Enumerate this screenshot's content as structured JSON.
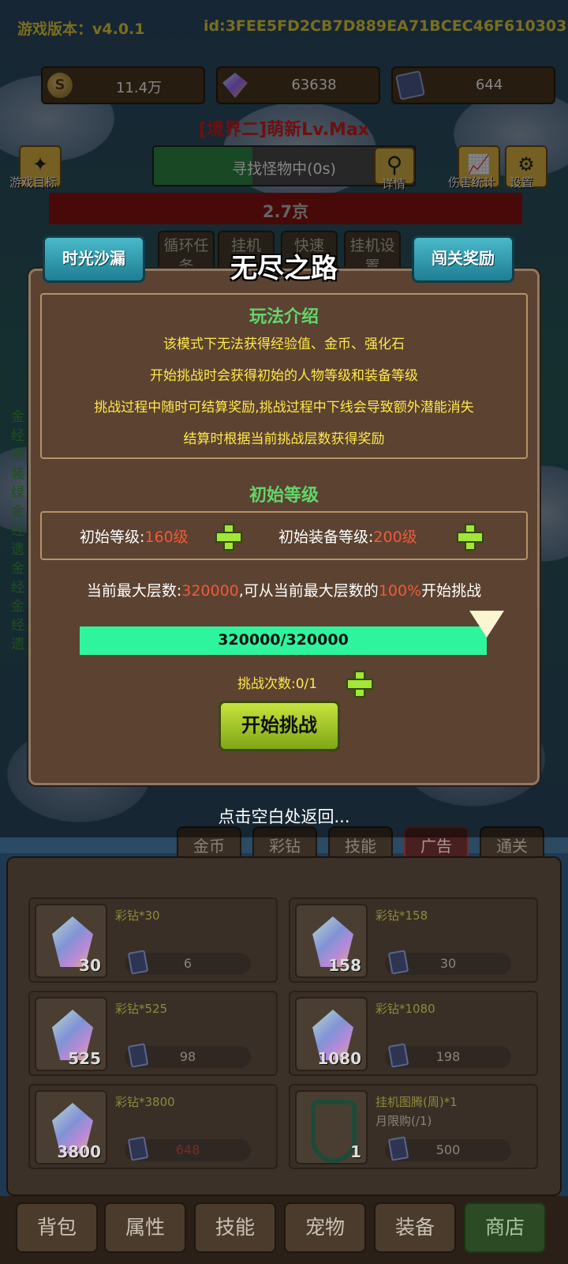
{
  "header": {
    "version": "游戏版本：v4.0.1",
    "device_id": "id:3FEE5FD2CB7D889EA71BCEC46F610303",
    "resources": [
      {
        "icon": "coin-icon",
        "value": "11.4万"
      },
      {
        "icon": "gem-icon",
        "value": "63638"
      },
      {
        "icon": "ticket-icon",
        "value": "644"
      }
    ],
    "rank_title": "[境界二]萌新Lv.Max",
    "goal_label": "游戏目标",
    "search_status": "寻找怪物中(0s)",
    "detail_label": "详情",
    "damage_stats_label": "伤害统计",
    "settings_label": "设置",
    "hp_text": "2.7京"
  },
  "behind_menu": [
    "循环任务",
    "挂机",
    "快速",
    "挂机设置"
  ],
  "side_list": [
    "金",
    "经",
    "遗",
    "装",
    "绿",
    "金",
    "经",
    "遗",
    "金",
    "经",
    "金",
    "经",
    "遗"
  ],
  "panel": {
    "title": "无尽之路",
    "left_button": "时光沙漏",
    "right_button": "闯关奖励",
    "intro": {
      "title": "玩法介绍",
      "lines": [
        "该模式下无法获得经验值、金币、强化石",
        "开始挑战时会获得初始的人物等级和装备等级",
        "挑战过程中随时可结算奖励,挑战过程中下线会导致额外潜能消失",
        "结算时根据当前挑战层数获得奖励"
      ]
    },
    "initial_title": "初始等级",
    "initial_level_label": "初始等级:",
    "initial_level_value": "160级",
    "initial_equip_label": "初始装备等级:",
    "initial_equip_value": "200级",
    "max_line": {
      "prefix": "当前最大层数:",
      "layers": "320000",
      "middle": ",可从当前最大层数的",
      "percent": "100%",
      "suffix": "开始挑战"
    },
    "progress": {
      "text": "320000/320000",
      "fraction": 1.0
    },
    "tries": "挑战次数:0/1",
    "start_button": "开始挑战"
  },
  "back_hint": "点击空白处返回...",
  "shop": {
    "tabs": [
      "金币",
      "彩钻",
      "技能",
      "广告",
      "通关"
    ],
    "active_tab": "广告",
    "items": [
      {
        "name": "彩钻*30",
        "qty": "30",
        "price": "6",
        "price_red": false
      },
      {
        "name": "彩钻*158",
        "qty": "158",
        "price": "30",
        "price_red": false
      },
      {
        "name": "彩钻*525",
        "qty": "525",
        "price": "98",
        "price_red": false
      },
      {
        "name": "彩钻*1080",
        "qty": "1080",
        "price": "198",
        "price_red": false
      },
      {
        "name": "彩钻*3800",
        "qty": "3800",
        "price": "648",
        "price_red": true
      },
      {
        "name": "挂机图腾(周)*1",
        "qty": "1",
        "price": "500",
        "price_red": false,
        "sub": "月限购(/1)"
      }
    ]
  },
  "bottom_nav": [
    "背包",
    "属性",
    "技能",
    "宠物",
    "装备",
    "商店"
  ],
  "bottom_active": "商店"
}
